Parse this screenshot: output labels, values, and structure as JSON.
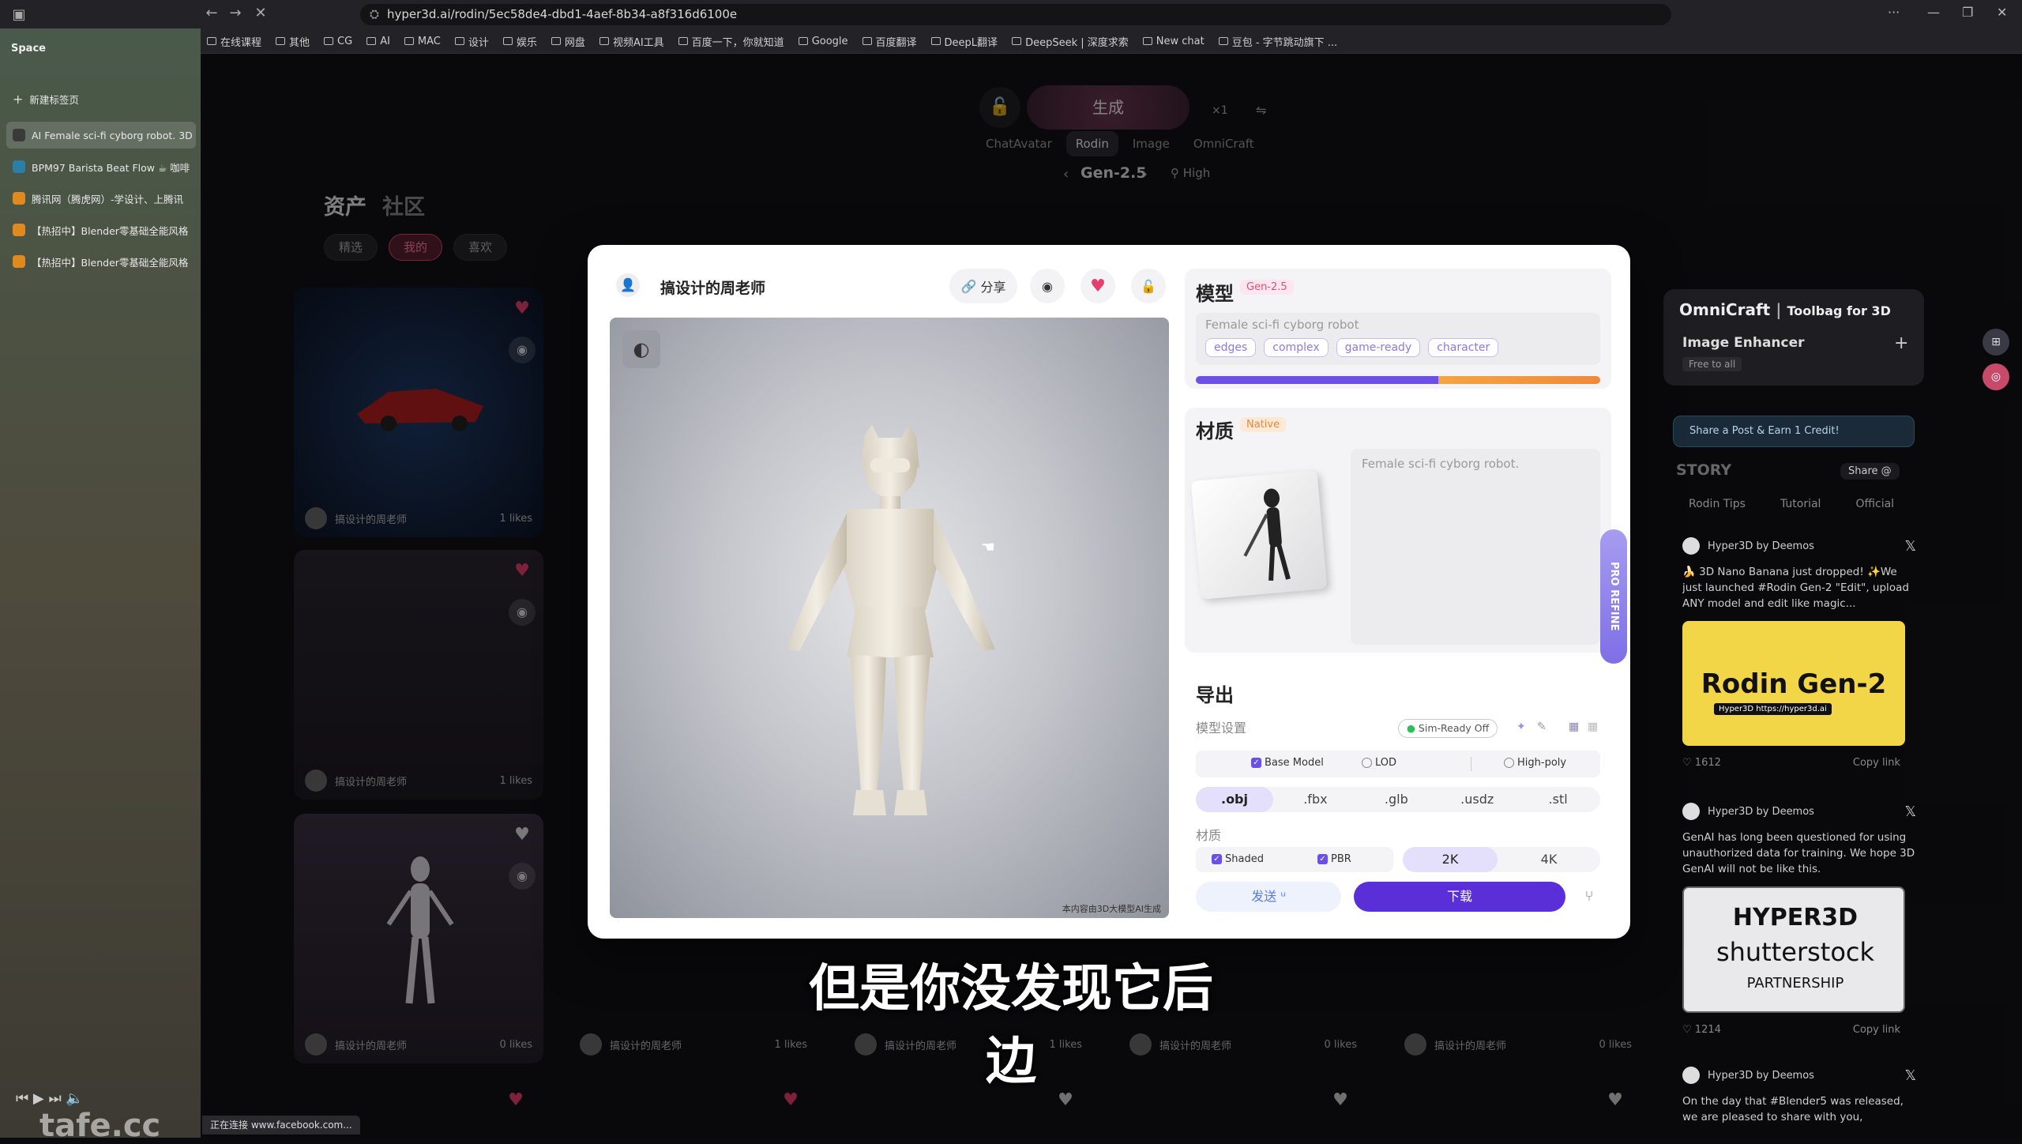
{
  "browser": {
    "url": "hyper3d.ai/rodin/5ec58de4-dbd1-4aef-8b34-a8f316d6100e",
    "space_label": "Space",
    "new_tab": "新建标签页",
    "bookmarks": [
      "在线课程",
      "其他",
      "CG",
      "AI",
      "MAC",
      "设计",
      "娱乐",
      "网盘",
      "视频AI工具",
      "百度一下，你就知道",
      "Google",
      "百度翻译",
      "DeepL翻译",
      "DeepSeek | 深度求索",
      "New chat",
      "豆包 - 字节跳动旗下 ..."
    ],
    "tabs": [
      {
        "label": "AI Female sci-fi cyborg robot. 3D",
        "color": "#3a3a3a"
      },
      {
        "label": "BPM97 Barista Beat Flow ☕ 咖啡",
        "color": "#2a7fa8"
      },
      {
        "label": "腾讯网（腾虎网）-学设计、上腾讯",
        "color": "#e08a1e"
      },
      {
        "label": "【热招中】Blender零基础全能风格",
        "color": "#e08a1e"
      },
      {
        "label": "【热招中】Blender零基础全能风格",
        "color": "#e08a1e"
      }
    ],
    "status_text": "正在连接 www.facebook.com..."
  },
  "header": {
    "generate": "生成",
    "modes": [
      "ChatAvatar",
      "Rodin",
      "Image",
      "OmniCraft"
    ],
    "active_mode": "Rodin",
    "version": "Gen-2.5",
    "quality": "High",
    "count": "×1"
  },
  "library": {
    "tab_assets": "资产",
    "tab_community": "社区",
    "filters": [
      "精选",
      "我的",
      "喜欢"
    ],
    "active_filter": "我的",
    "cards": [
      {
        "author": "搞设计的周老师",
        "likes": "1 likes"
      },
      {
        "author": "搞设计的周老师",
        "likes": "1 likes"
      },
      {
        "author": "搞设计的周老师",
        "likes": "0 likes"
      },
      {
        "author": "搞设计的周老师",
        "likes": "1 likes"
      },
      {
        "author": "搞设计的周老师",
        "likes": "1 likes"
      },
      {
        "author": "搞设计的周老师",
        "likes": "0 likes"
      },
      {
        "author": "搞设计的周老师",
        "likes": "0 likes"
      }
    ]
  },
  "modal": {
    "author": "搞设计的周老师",
    "share_label": "分享",
    "viewport_caption": "本内容由3D大模型AI生成",
    "model": {
      "title": "模型",
      "badge": "Gen-2.5",
      "prompt": "Female sci-fi cyborg robot",
      "tags": [
        "edges",
        "complex",
        "game-ready",
        "character"
      ],
      "progress": 0.6
    },
    "material": {
      "title": "材质",
      "badge": "Native",
      "prompt": "Female sci-fi cyborg robot."
    },
    "pro_refine": "PRO REFINE",
    "export": {
      "title": "导出",
      "settings_label": "模型设置",
      "sim_ready": "Sim-Ready Off",
      "options": [
        {
          "label": "Base Model",
          "checked": true
        },
        {
          "label": "LOD",
          "checked": false
        },
        {
          "label": "High-poly",
          "checked": false
        }
      ],
      "formats": [
        ".obj",
        ".fbx",
        ".glb",
        ".usdz",
        ".stl"
      ],
      "active_format": ".obj",
      "material_label": "材质",
      "material_opts": [
        "Shaded",
        "PBR"
      ],
      "resolutions": [
        "2K",
        "4K"
      ],
      "active_resolution": "2K",
      "send_label": "发送",
      "download_label": "下载"
    }
  },
  "right": {
    "omnicraft": "OmniCraft",
    "toolbag": "Toolbag for 3D",
    "image_enhancer": "Image Enhancer",
    "free_to_all": "Free to all",
    "share_post": "Share a Post & Earn 1 Credit!",
    "story": "STORY",
    "share_btn": "Share @",
    "story_tabs": [
      "Rodin Tips",
      "Tutorial",
      "Official"
    ],
    "posts": [
      {
        "author": "Hyper3D by Deemos",
        "text": "🍌 3D Nano Banana just dropped! ✨We just launched #Rodin Gen-2 \"Edit\", upload ANY model and edit like magic...",
        "img_title": "Rodin Gen-2",
        "img_sub": "Hyper3D https://hyper3d.ai",
        "likes": "1612",
        "copy": "Copy link"
      },
      {
        "author": "Hyper3D by Deemos",
        "text": "GenAI has long been questioned for using unauthorized data for training. We hope 3D GenAI will not be like this.",
        "img_title": "HYPER3D",
        "img_sub2": "shutterstock",
        "img_sub": "PARTNERSHIP",
        "likes": "1214",
        "copy": "Copy link"
      },
      {
        "author": "Hyper3D by Deemos",
        "text": "On the day that #Blender5 was released, we are pleased to share with you,"
      }
    ]
  },
  "subtitle": "但是你没发现它后边",
  "watermark": "tafe.cc",
  "colors": {
    "accent": "#5a2fd8",
    "heart": "#e63e6d",
    "gradient_start": "#6b4fe6",
    "gradient_end": "#f08a3a"
  }
}
